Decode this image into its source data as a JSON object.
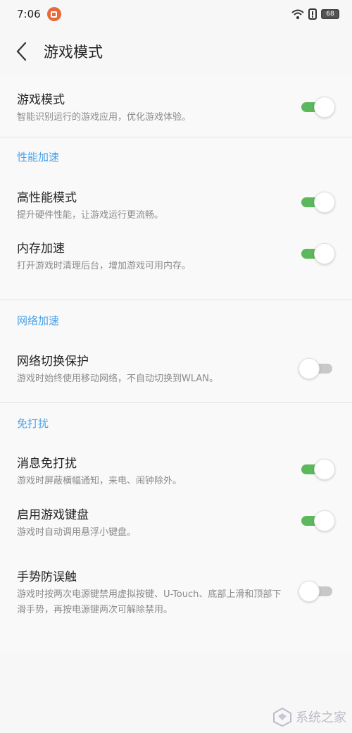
{
  "status": {
    "time": "7:06",
    "battery": "68"
  },
  "header": {
    "title": "游戏模式"
  },
  "game_mode": {
    "title": "游戏模式",
    "desc": "智能识别运行的游戏应用，优化游戏体验。",
    "on": true
  },
  "performance": {
    "header": "性能加速",
    "items": [
      {
        "title": "高性能模式",
        "desc": "提升硬件性能，让游戏运行更流畅。",
        "on": true
      },
      {
        "title": "内存加速",
        "desc": "打开游戏时清理后台，增加游戏可用内存。",
        "on": true
      }
    ]
  },
  "network": {
    "header": "网络加速",
    "items": [
      {
        "title": "网络切换保护",
        "desc": "游戏时始终使用移动网络，不自动切换到WLAN。",
        "on": false
      }
    ]
  },
  "dnd": {
    "header": "免打扰",
    "items": [
      {
        "title": "消息免打扰",
        "desc": "游戏时屏蔽横幅通知，来电、闹钟除外。",
        "on": true
      },
      {
        "title": "启用游戏键盘",
        "desc": "游戏时自动调用悬浮小键盘。",
        "on": true
      },
      {
        "title": "手势防误触",
        "desc": "游戏时按两次电源键禁用虚拟按键、U-Touch、底部上滑和顶部下滑手势，再按电源键两次可解除禁用。",
        "on": false
      }
    ]
  },
  "watermark": {
    "text": "系统之家"
  },
  "colors": {
    "accent_blue": "#4aa1e8",
    "toggle_on": "#5cb85c",
    "toggle_off": "#c8c8c8"
  }
}
